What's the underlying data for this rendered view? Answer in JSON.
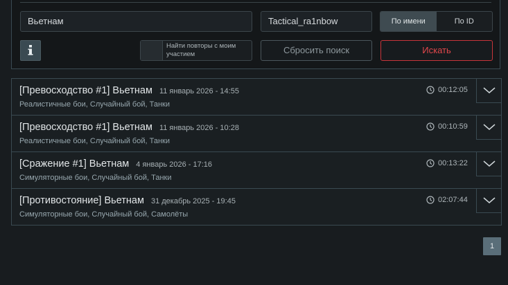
{
  "search": {
    "map_value": "Вьетнам",
    "player_value": "Tactical_ra1nbow",
    "mode_options": [
      "По имени",
      "По ID"
    ],
    "mode_selected": "По имени",
    "replay_toggle_label": "Найти повторы с моим участием",
    "reset_label": "Сбросить поиск",
    "search_label": "Искать"
  },
  "replays": [
    {
      "title": "[Превосходство #1] Вьетнам",
      "date": "11 январь 2026 - 14:55",
      "tags": "Реалистичные бои, Случайный бой, Танки",
      "duration": "00:12:05"
    },
    {
      "title": "[Превосходство #1] Вьетнам",
      "date": "11 январь 2026 - 10:28",
      "tags": "Реалистичные бои, Случайный бой, Танки",
      "duration": "00:10:59"
    },
    {
      "title": "[Сражение #1] Вьетнам",
      "date": "4 январь 2026 - 17:16",
      "tags": "Симуляторные бои, Случайный бой, Танки",
      "duration": "00:13:22"
    },
    {
      "title": "[Противостояние] Вьетнам",
      "date": "31 декабрь 2025 - 19:45",
      "tags": "Симуляторные бои, Случайный бой, Самолёты",
      "duration": "02:07:44"
    }
  ],
  "pagination": {
    "current_page": "1"
  },
  "colors": {
    "accent_red": "#e0474b",
    "border": "#3a4a52",
    "active_segment": "#3f4b51"
  }
}
